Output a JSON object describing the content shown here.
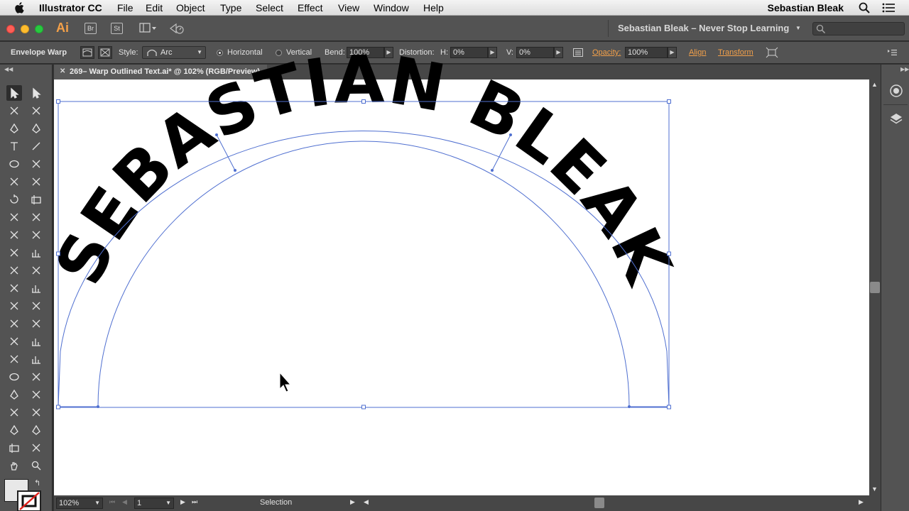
{
  "menubar": {
    "app_name": "Illustrator CC",
    "items": [
      "File",
      "Edit",
      "Object",
      "Type",
      "Select",
      "Effect",
      "View",
      "Window",
      "Help"
    ],
    "user": "Sebastian Bleak"
  },
  "appbar": {
    "logo": "Ai",
    "bridge": "Br",
    "stock": "St",
    "workspace": "Sebastian Bleak – Never Stop Learning"
  },
  "control": {
    "tool_label": "Envelope Warp",
    "style_label": "Style:",
    "style_value": "Arc",
    "horizontal": "Horizontal",
    "vertical": "Vertical",
    "bend_label": "Bend:",
    "bend_value": "100%",
    "distortion_label": "Distortion:",
    "h_label": "H:",
    "h_value": "0%",
    "v_label": "V:",
    "v_value": "0%",
    "opacity_label": "Opacity:",
    "opacity_value": "100%",
    "align": "Align",
    "transform": "Transform"
  },
  "document": {
    "tab_title": "269– Warp Outlined Text.ai* @ 102% (RGB/Preview)"
  },
  "artwork": {
    "text": "SEBASTIAN BLEAK"
  },
  "status": {
    "zoom": "102%",
    "page": "1",
    "tool": "Selection"
  }
}
